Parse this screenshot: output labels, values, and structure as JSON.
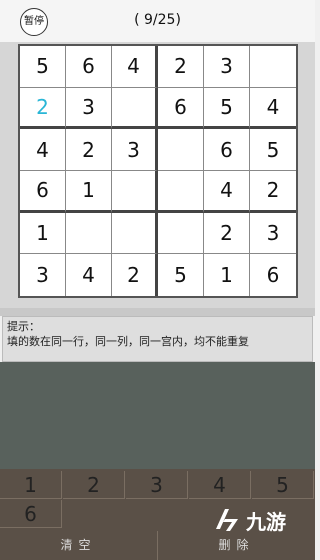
{
  "header": {
    "pause_label": "暂停",
    "progress": "( 9/25)"
  },
  "board": {
    "rows": [
      [
        "5",
        "6",
        "4",
        "2",
        "3",
        ""
      ],
      [
        "2",
        "3",
        "",
        "6",
        "5",
        "4"
      ],
      [
        "4",
        "2",
        "3",
        "",
        "6",
        "5"
      ],
      [
        "6",
        "1",
        "",
        "",
        "4",
        "2"
      ],
      [
        "1",
        "",
        "",
        "",
        "2",
        "3"
      ],
      [
        "3",
        "4",
        "2",
        "5",
        "1",
        "6"
      ]
    ],
    "user_entered_cells": [
      [
        1,
        0
      ]
    ],
    "user_digit_color": "#29b6d6"
  },
  "hint": {
    "label": "提示：",
    "text": "填的数在同一行，同一列，同一宫内，均不能重复"
  },
  "keypad": {
    "digits": [
      "1",
      "2",
      "3",
      "4",
      "5",
      "6"
    ],
    "clear_label": "清空",
    "delete_label": "删除"
  },
  "watermark": {
    "text": "九游"
  }
}
